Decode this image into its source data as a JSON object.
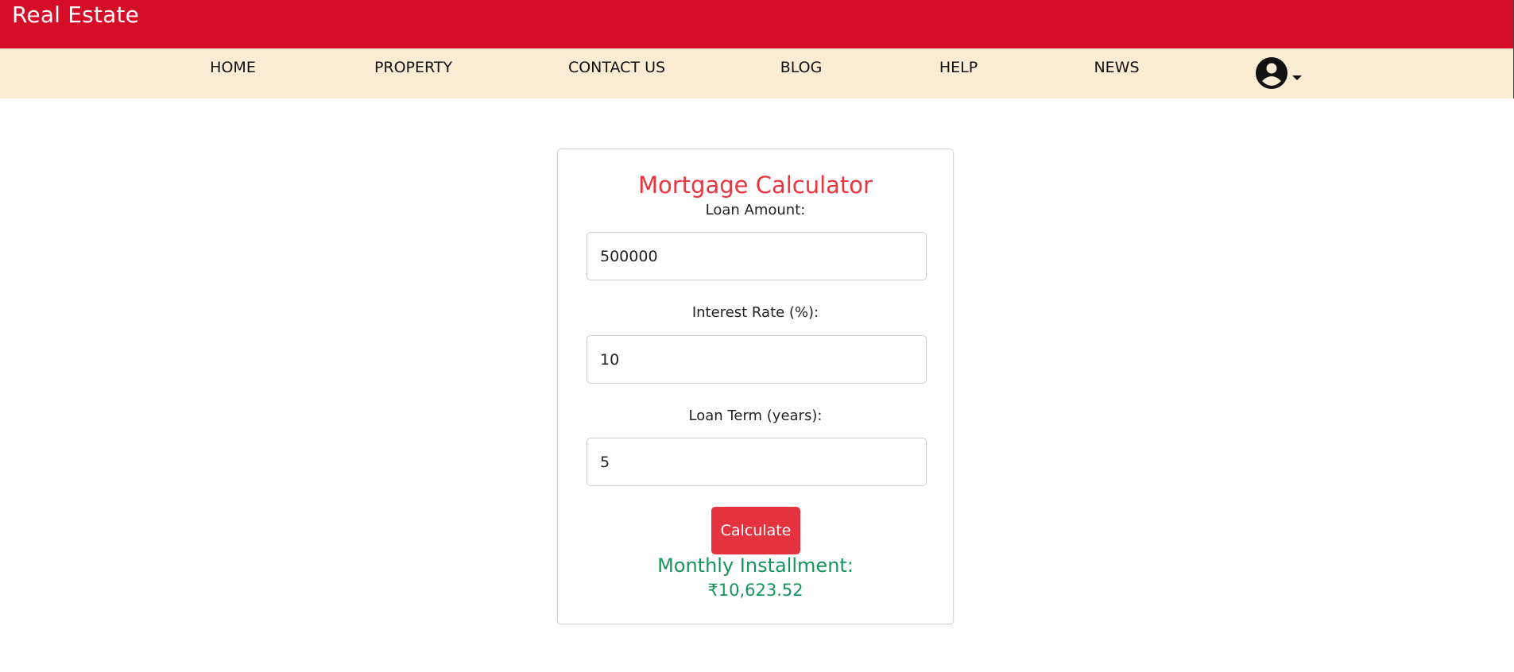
{
  "header": {
    "brand": "Real Estate",
    "brand_color": "#d50e28"
  },
  "nav": {
    "background": "#fbecd4",
    "items": [
      {
        "label": "HOME"
      },
      {
        "label": "PROPERTY"
      },
      {
        "label": "CONTACT US"
      },
      {
        "label": "BLOG"
      },
      {
        "label": "HELP"
      },
      {
        "label": "NEWS"
      }
    ],
    "profile_icon": "account-circle-icon",
    "dropdown_icon": "caret-down-icon"
  },
  "calculator": {
    "title": "Mortgage Calculator",
    "loan_amount": {
      "label": "Loan Amount:",
      "value": "500000"
    },
    "interest_rate": {
      "label": "Interest Rate (%):",
      "value": "10"
    },
    "loan_term": {
      "label": "Loan Term (years):",
      "value": "5"
    },
    "calculate_label": "Calculate",
    "result_label": "Monthly Installment:",
    "result_value": "₹10,623.52",
    "accent_color": "#e5323f",
    "result_color": "#16955a"
  }
}
